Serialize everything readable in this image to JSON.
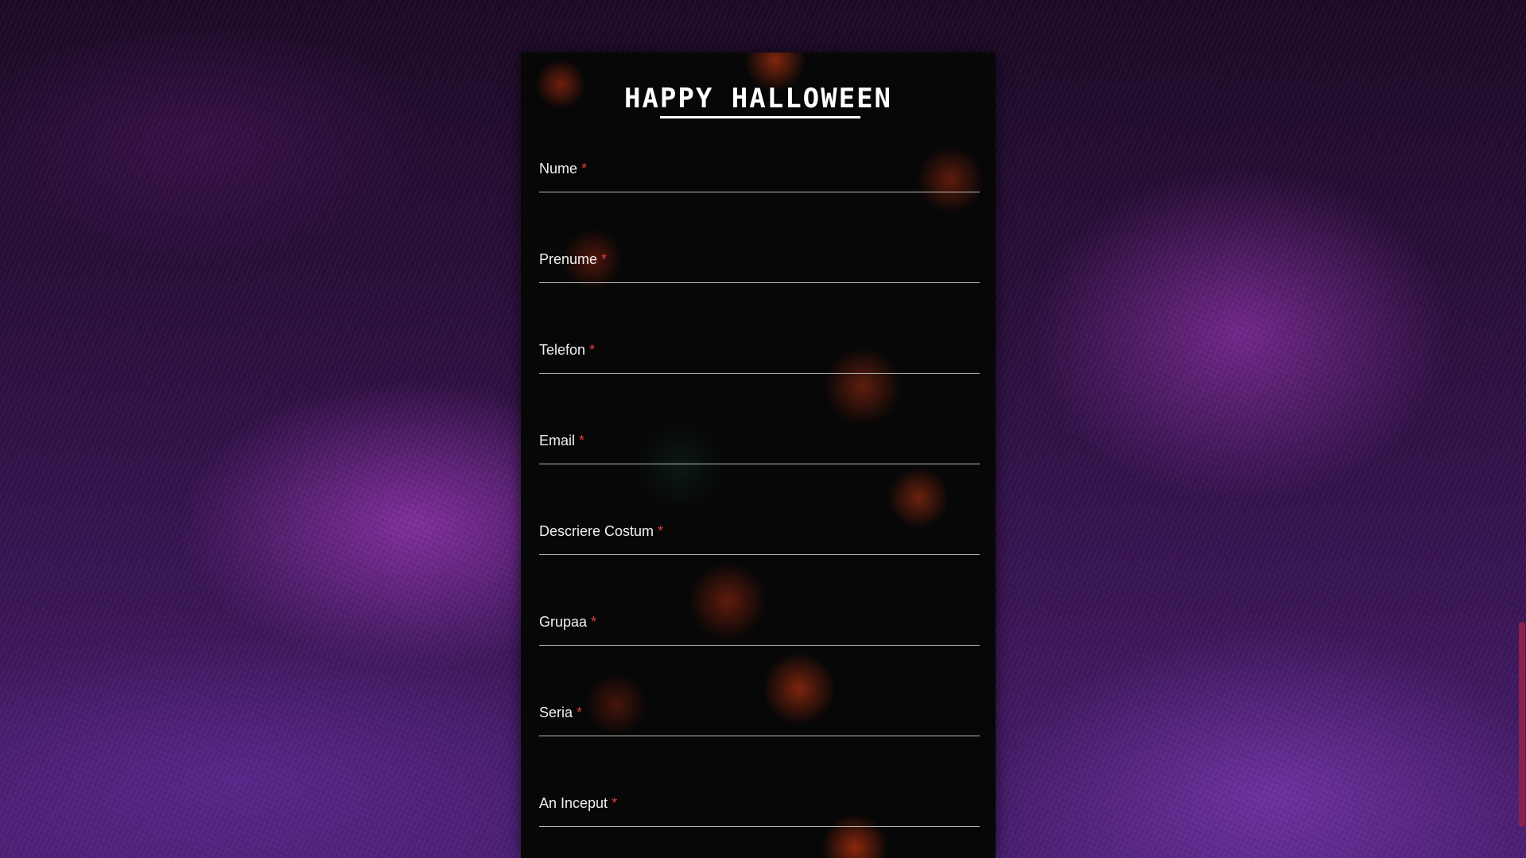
{
  "page": {
    "title": "HAPPY HALLOWEEN"
  },
  "form": {
    "fields": [
      {
        "label": "Nume",
        "required_mark": "*",
        "value": ""
      },
      {
        "label": "Prenume",
        "required_mark": "*",
        "value": ""
      },
      {
        "label": "Telefon",
        "required_mark": "*",
        "value": ""
      },
      {
        "label": "Email",
        "required_mark": "*",
        "value": ""
      },
      {
        "label": "Descriere Costum",
        "required_mark": "*",
        "value": ""
      },
      {
        "label": "Grupaa",
        "required_mark": "*",
        "value": ""
      },
      {
        "label": "Seria",
        "required_mark": "*",
        "value": ""
      },
      {
        "label": "An Inceput",
        "required_mark": "*",
        "value": ""
      }
    ]
  },
  "colors": {
    "required": "#e03b3b",
    "scrollbar_thumb": "#8a1f4e",
    "panel": "#070707",
    "background_accent": "#4a1f72"
  }
}
